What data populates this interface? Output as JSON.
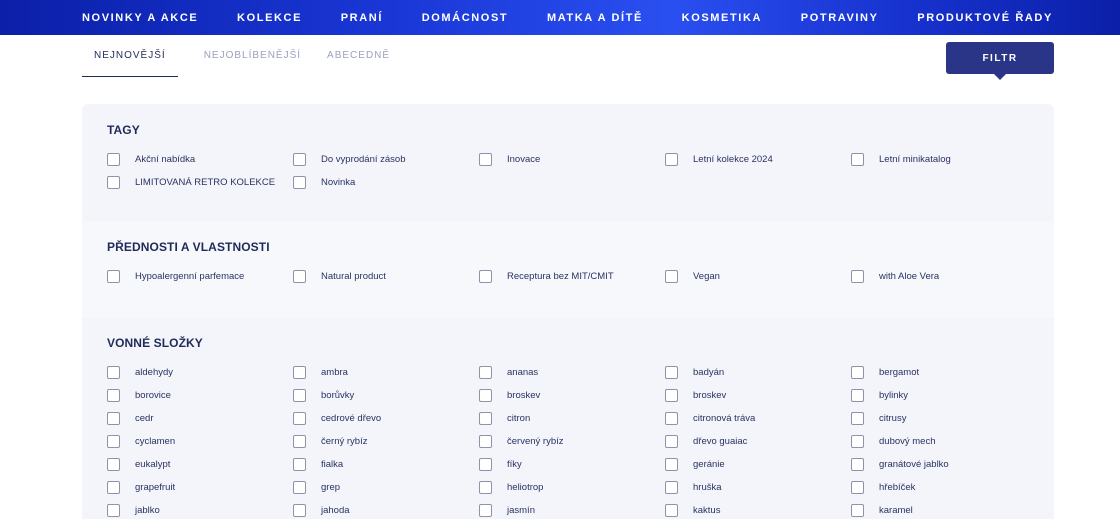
{
  "nav": [
    "NOVINKY A AKCE",
    "KOLEKCE",
    "PRANÍ",
    "DOMÁCNOST",
    "MATKA A DÍTĚ",
    "KOSMETIKA",
    "POTRAVINY",
    "PRODUKTOVÉ ŘADY"
  ],
  "sort": {
    "newest": "NEJNOVĚJŠÍ",
    "popular": "NEJOBLÍBENĚJŠÍ",
    "alpha": "ABECEDNĚ"
  },
  "filter_button": "FILTR",
  "sections": {
    "tags": {
      "title": "TAGY",
      "options": [
        "Akční nabídka",
        "Do vyprodání zásob",
        "Inovace",
        "Letní kolekce 2024",
        "Letní minikatalog",
        "LIMITOVANÁ RETRO KOLEKCE",
        "Novinka"
      ]
    },
    "features": {
      "title": "PŘEDNOSTI A VLASTNOSTI",
      "options": [
        "Hypoalergenní parfemace",
        "Natural product",
        "Receptura bez MIT/CMIT",
        "Vegan",
        "with Aloe Vera"
      ]
    },
    "scents": {
      "title": "VONNÉ SLOŽKY",
      "options": [
        "aldehydy",
        "ambra",
        "ananas",
        "badyán",
        "bergamot",
        "borovice",
        "borůvky",
        "broskev",
        "broskev",
        "bylinky",
        "cedr",
        "cedrové dřevo",
        "citron",
        "citronová tráva",
        "citrusy",
        "cyclamen",
        "černý rybíz",
        "červený rybíz",
        "dřevo guaiac",
        "dubový mech",
        "eukalypt",
        "fialka",
        "fíky",
        "geránie",
        "granátové jablko",
        "grapefruit",
        "grep",
        "heliotrop",
        "hruška",
        "hřebíček",
        "jablko",
        "jahoda",
        "jasmín",
        "kaktus",
        "karamel"
      ]
    }
  }
}
